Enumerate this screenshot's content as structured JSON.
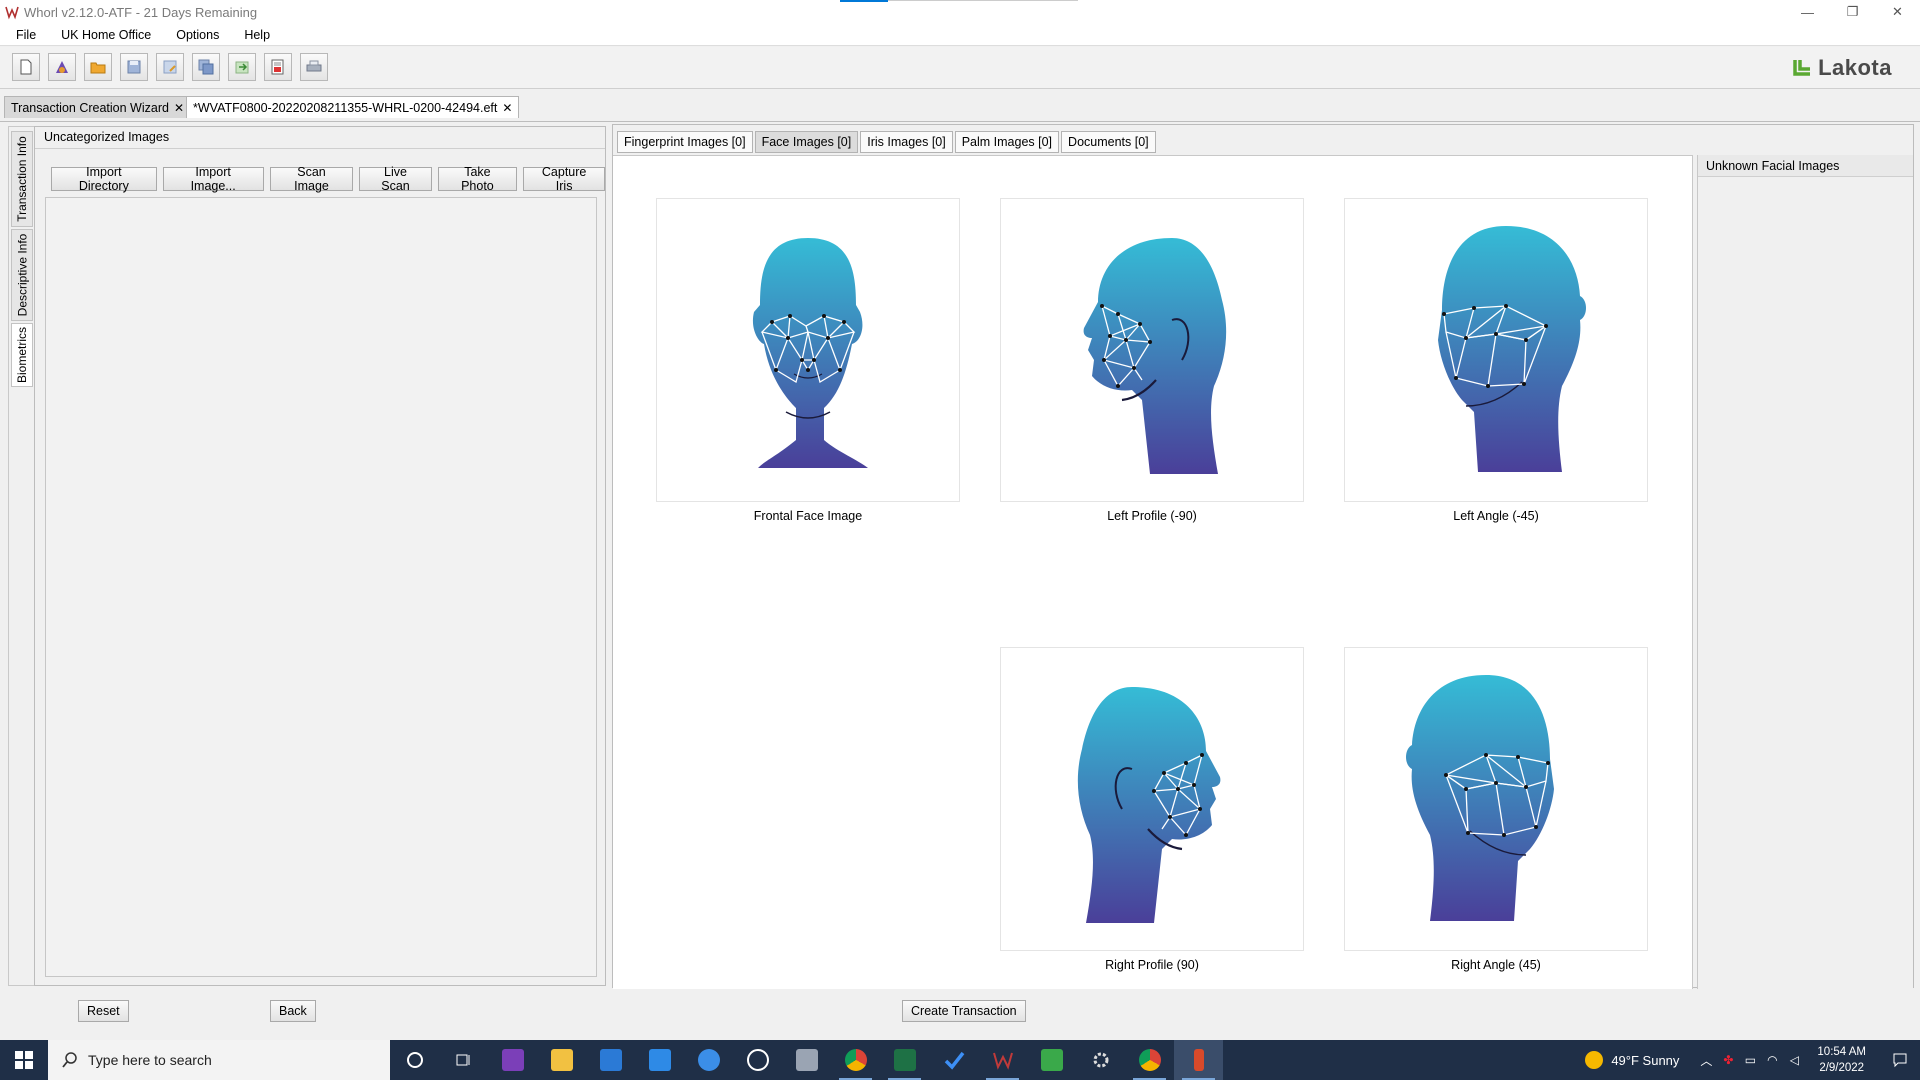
{
  "window": {
    "title": "Whorl v2.12.0-ATF - 21 Days Remaining",
    "minimize": "—",
    "restore": "❐",
    "close": "✕"
  },
  "menu": [
    "File",
    "UK Home Office",
    "Options",
    "Help"
  ],
  "brand": {
    "name": "Lakota",
    "color": "#5aa832"
  },
  "doc_tabs": [
    {
      "label": "Transaction Creation Wizard",
      "close": "✕"
    },
    {
      "label": "*WVATF0800-20220208211355-WHRL-0200-42494.eft",
      "close": "✕"
    }
  ],
  "side_tabs": [
    "Transaction Info",
    "Descriptive Info",
    "Biometrics"
  ],
  "left_panel": {
    "title": "Uncategorized Images",
    "buttons": [
      "Import Directory",
      "Import Image...",
      "Scan Image",
      "Live Scan",
      "Take Photo",
      "Capture Iris"
    ]
  },
  "content_tabs": [
    "Fingerprint Images [0]",
    "Face Images [0]",
    "Iris Images [0]",
    "Palm Images [0]",
    "Documents [0]"
  ],
  "faces": [
    {
      "label": "Frontal Face Image",
      "pose": "frontal"
    },
    {
      "label": "Left Profile (-90)",
      "pose": "left-profile"
    },
    {
      "label": "Left Angle (-45)",
      "pose": "left-angle"
    },
    {
      "label": "Right Profile (90)",
      "pose": "right-profile"
    },
    {
      "label": "Right Angle (45)",
      "pose": "right-angle"
    }
  ],
  "side_panel": {
    "title": "Unknown Facial Images"
  },
  "bottom": {
    "reset": "Reset",
    "back": "Back",
    "create": "Create Transaction"
  },
  "taskbar": {
    "search_placeholder": "Type here to search",
    "weather": "49°F  Sunny",
    "time": "10:54 AM",
    "date": "2/9/2022"
  },
  "colors": {
    "accent": "#0078d7",
    "face_top": "#35bcd6",
    "face_bottom": "#4a3f99",
    "taskbar": "#1f2f47"
  }
}
